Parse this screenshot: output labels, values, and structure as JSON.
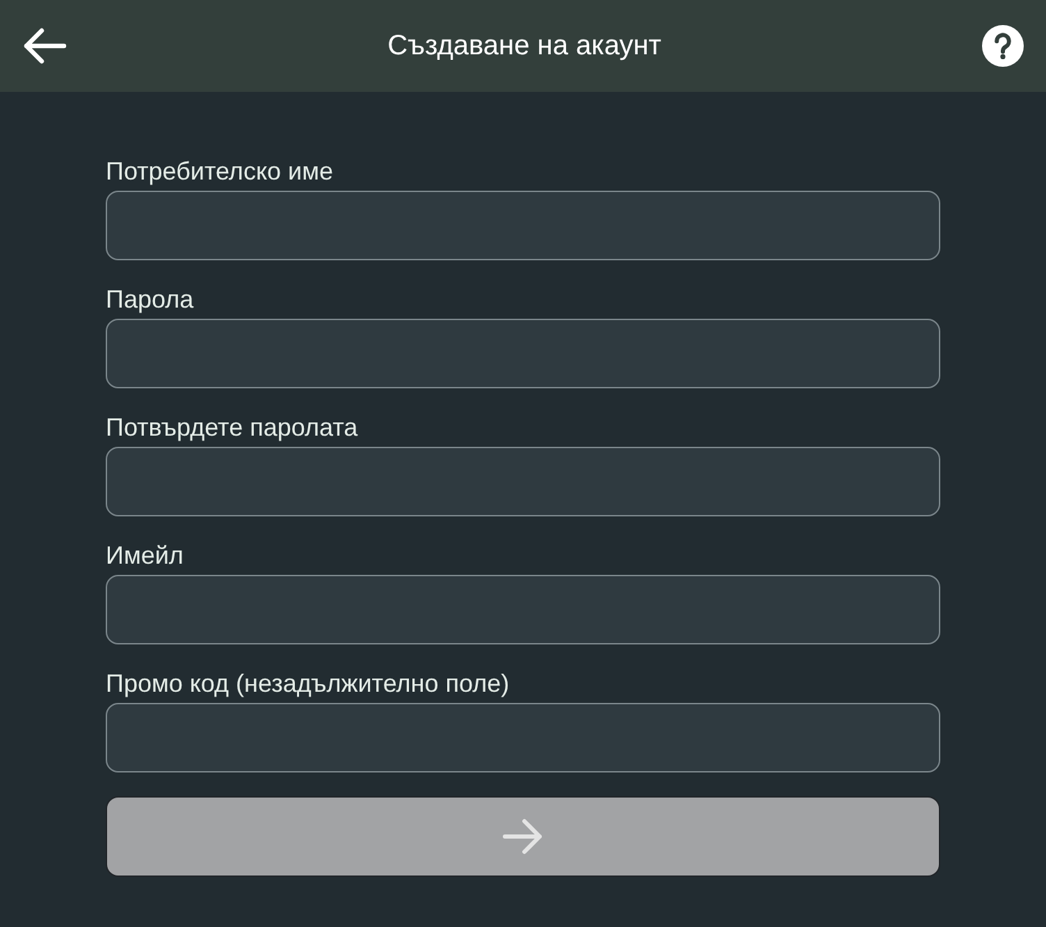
{
  "header": {
    "title": "Създаване на акаунт"
  },
  "fields": [
    {
      "label": "Потребителско име"
    },
    {
      "label": "Парола"
    },
    {
      "label": "Потвърдете паролата"
    },
    {
      "label": "Имейл"
    },
    {
      "label": "Промо код (незадължително поле)"
    }
  ],
  "submit_button": {
    "disabled": true
  }
}
